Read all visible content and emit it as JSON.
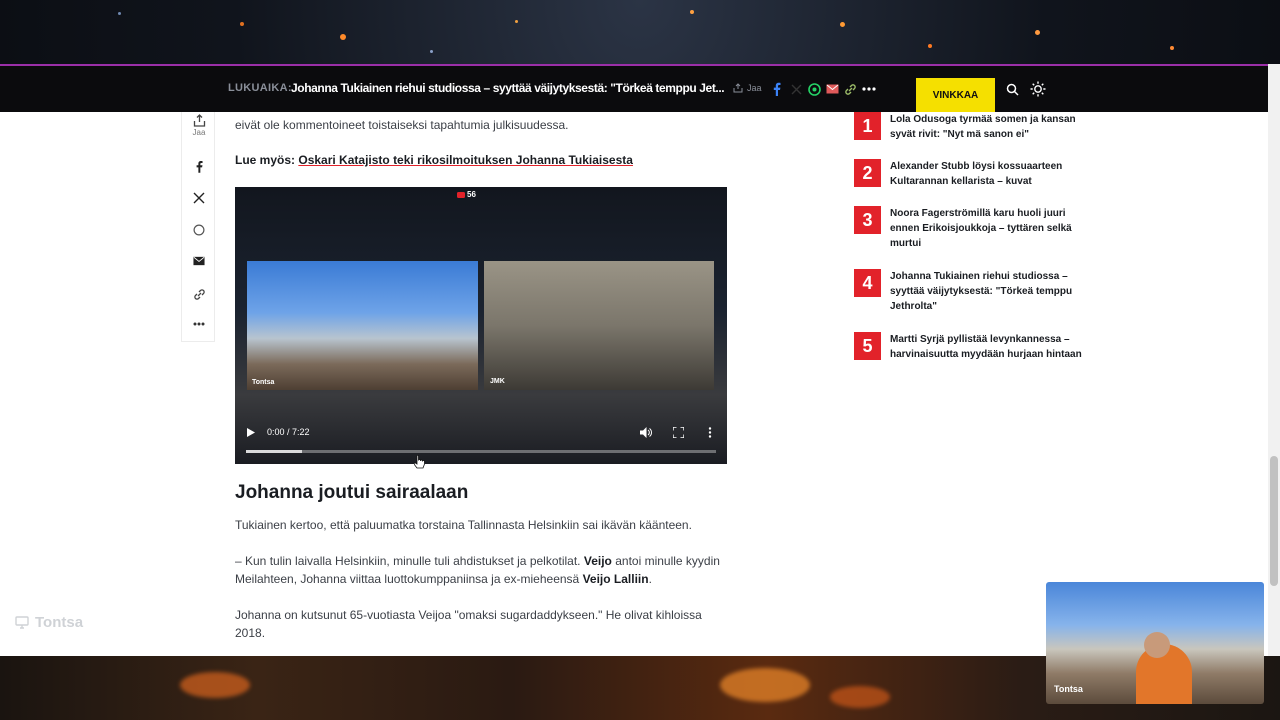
{
  "topbar": {
    "kicker": "LUKUAIKA:",
    "headline": "Johanna Tukiainen riehui studiossa – syyttää väijytyksestä: \"Törkeä temppu Jet...",
    "share_label": "Jaa",
    "vinkkaa_label": "VINKKAA"
  },
  "share_rail": {
    "share_label": "Jaa"
  },
  "article": {
    "intro_text": "eivät ole kommentoineet toistaiseksi tapahtumia julkisuudessa.",
    "read_more_label": "Lue myös:",
    "read_more_link": "Oskari Katajisto teki rikosilmoituksen Johanna Tukiaisesta",
    "heading": "Johanna joutui sairaalaan",
    "p1": "Tukiainen kertoo, että paluumatka torstaina Tallinnasta Helsinkiin sai ikävän käänteen.",
    "p2_a": "– Kun tulin laivalla Helsinkiin, minulle tuli ahdistukset ja pelkotilat.",
    "p2_b": "Veijo",
    "p2_c": "antoi minulle kyydin Meilahteen, Johanna viittaa luottokumppaniinsa ja ex-mieheensä",
    "p2_d": "Veijo Lalliin",
    "p3": "Johanna on kutsunut 65-vuotiasta Veijoa \"omaksi sugardaddykseen.\" He olivat kihloissa 2018."
  },
  "video": {
    "live_count": "56",
    "time": "0:00 / 7:22",
    "progress": 0.12,
    "cam_left_label": "Tontsa",
    "cam_right_label": "JMK"
  },
  "trending": [
    {
      "num": "1",
      "title": "Lola Odusoga tyrmää somen ja kansan syvät rivit: \"Nyt mä sanon ei\""
    },
    {
      "num": "2",
      "title": "Alexander Stubb löysi kossuaarteen Kultarannan kellarista – kuvat"
    },
    {
      "num": "3",
      "title": "Noora Fagerströmillä karu huoli juuri ennen Erikoisjoukkoja – tyttären selkä murtui"
    },
    {
      "num": "4",
      "title": "Johanna Tukiainen riehui studiossa – syyttää väijytyksestä: \"Törkeä temppu Jethrolta\""
    },
    {
      "num": "5",
      "title": "Martti Syrjä pyllistää levynkannessa – harvinaisuutta myydään hurjaan hintaan"
    }
  ],
  "overlay": {
    "watermark": "Tontsa",
    "cam_label": "Tontsa"
  },
  "colors": {
    "accent_red": "#e2222a",
    "vinkkaa_yellow": "#f5e000",
    "topbar_bg": "#0b0b0d"
  }
}
